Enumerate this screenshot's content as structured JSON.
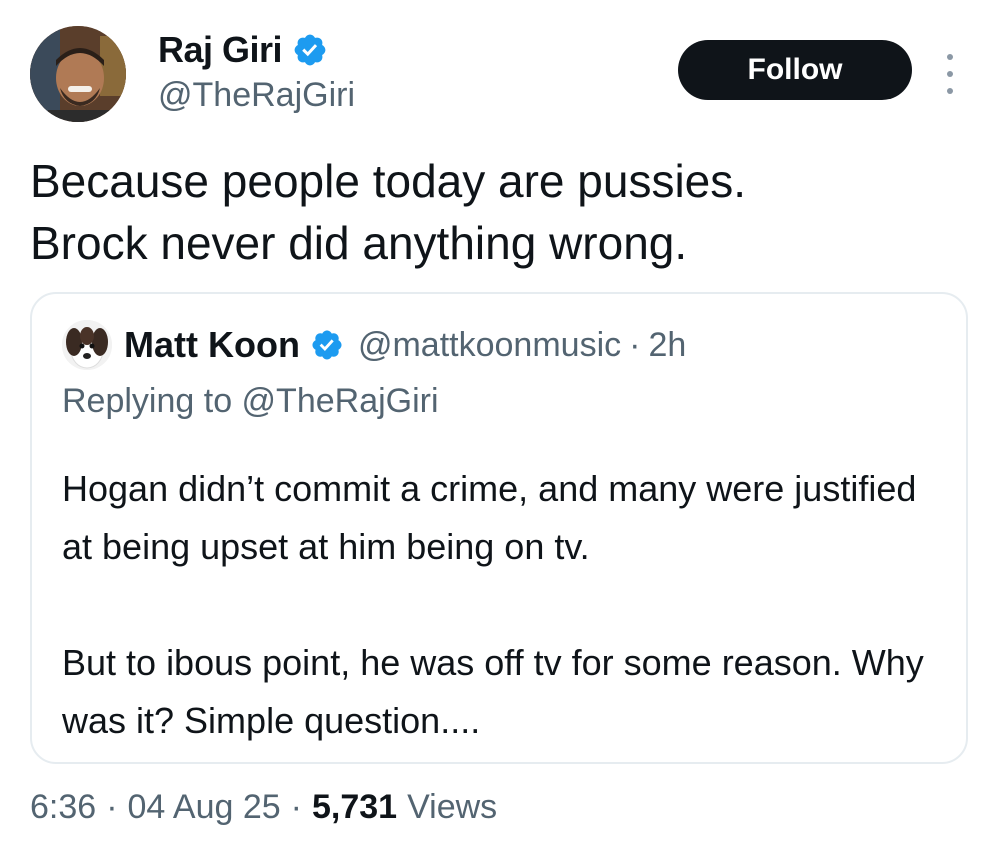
{
  "author": {
    "display_name": "Raj Giri",
    "handle": "@TheRajGiri",
    "verified": true,
    "avatar_icon": "profile-photo-man-smiling"
  },
  "actions": {
    "follow_label": "Follow",
    "more_icon": "vertical-ellipsis-icon"
  },
  "tweet": {
    "text": "Because people today are pussies.\nBrock never did anything wrong."
  },
  "quoted": {
    "display_name": "Matt Koon",
    "handle": "@mattkoonmusic",
    "separator": "·",
    "time": "2h",
    "verified": true,
    "avatar_icon": "dog-profile-photo",
    "replying_to": "Replying to @TheRajGiri",
    "text": "Hogan didn’t commit a crime, and many were justified at being upset at him being on tv.\n\nBut to ibous point, he was off tv for some reason. Why was it? Simple question...."
  },
  "meta": {
    "time": "6:36",
    "dot1": "·",
    "date": "04 Aug 25",
    "dot2": "·",
    "views_count": "5,731",
    "views_label": "Views"
  },
  "colors": {
    "verified_blue": "#1d9bf0",
    "secondary_text": "#536471",
    "primary_text": "#0f1419",
    "border": "#e6ecf0"
  }
}
